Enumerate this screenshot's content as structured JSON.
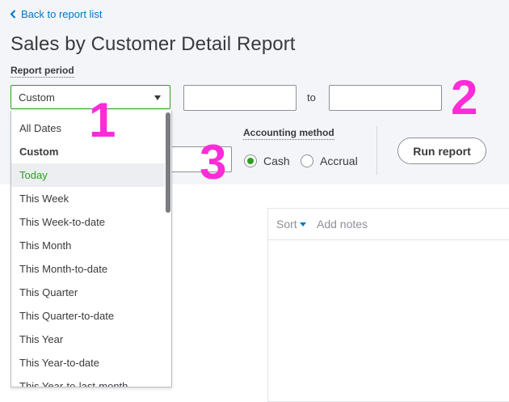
{
  "back_link": {
    "label": "Back to report list",
    "icon": "chevron-left-icon"
  },
  "title": "Sales by Customer Detail Report",
  "report_period": {
    "label": "Report period",
    "selected": "Custom",
    "from_value": "",
    "to_label": "to",
    "to_value": ""
  },
  "accounting_method": {
    "label": "Accounting method",
    "options": [
      {
        "label": "Cash",
        "selected": true
      },
      {
        "label": "Accrual",
        "selected": false
      }
    ]
  },
  "run_report_label": "Run report",
  "report_toolbar": {
    "sort_label": "Sort",
    "notes_label": "Add notes"
  },
  "period_options": [
    "All Dates",
    "Custom",
    "Today",
    "This Week",
    "This Week-to-date",
    "This Month",
    "This Month-to-date",
    "This Quarter",
    "This Quarter-to-date",
    "This Year",
    "This Year-to-date",
    "This Year-to-last-month"
  ],
  "period_options_bold_index": 1,
  "period_options_highlight_index": 2,
  "annotations": [
    "1",
    "2",
    "3"
  ],
  "colors": {
    "accent_green": "#2ca01c",
    "link_blue": "#0077c5",
    "annotation_magenta": "#ff2bd8",
    "band_gray": "#f4f5f8"
  }
}
